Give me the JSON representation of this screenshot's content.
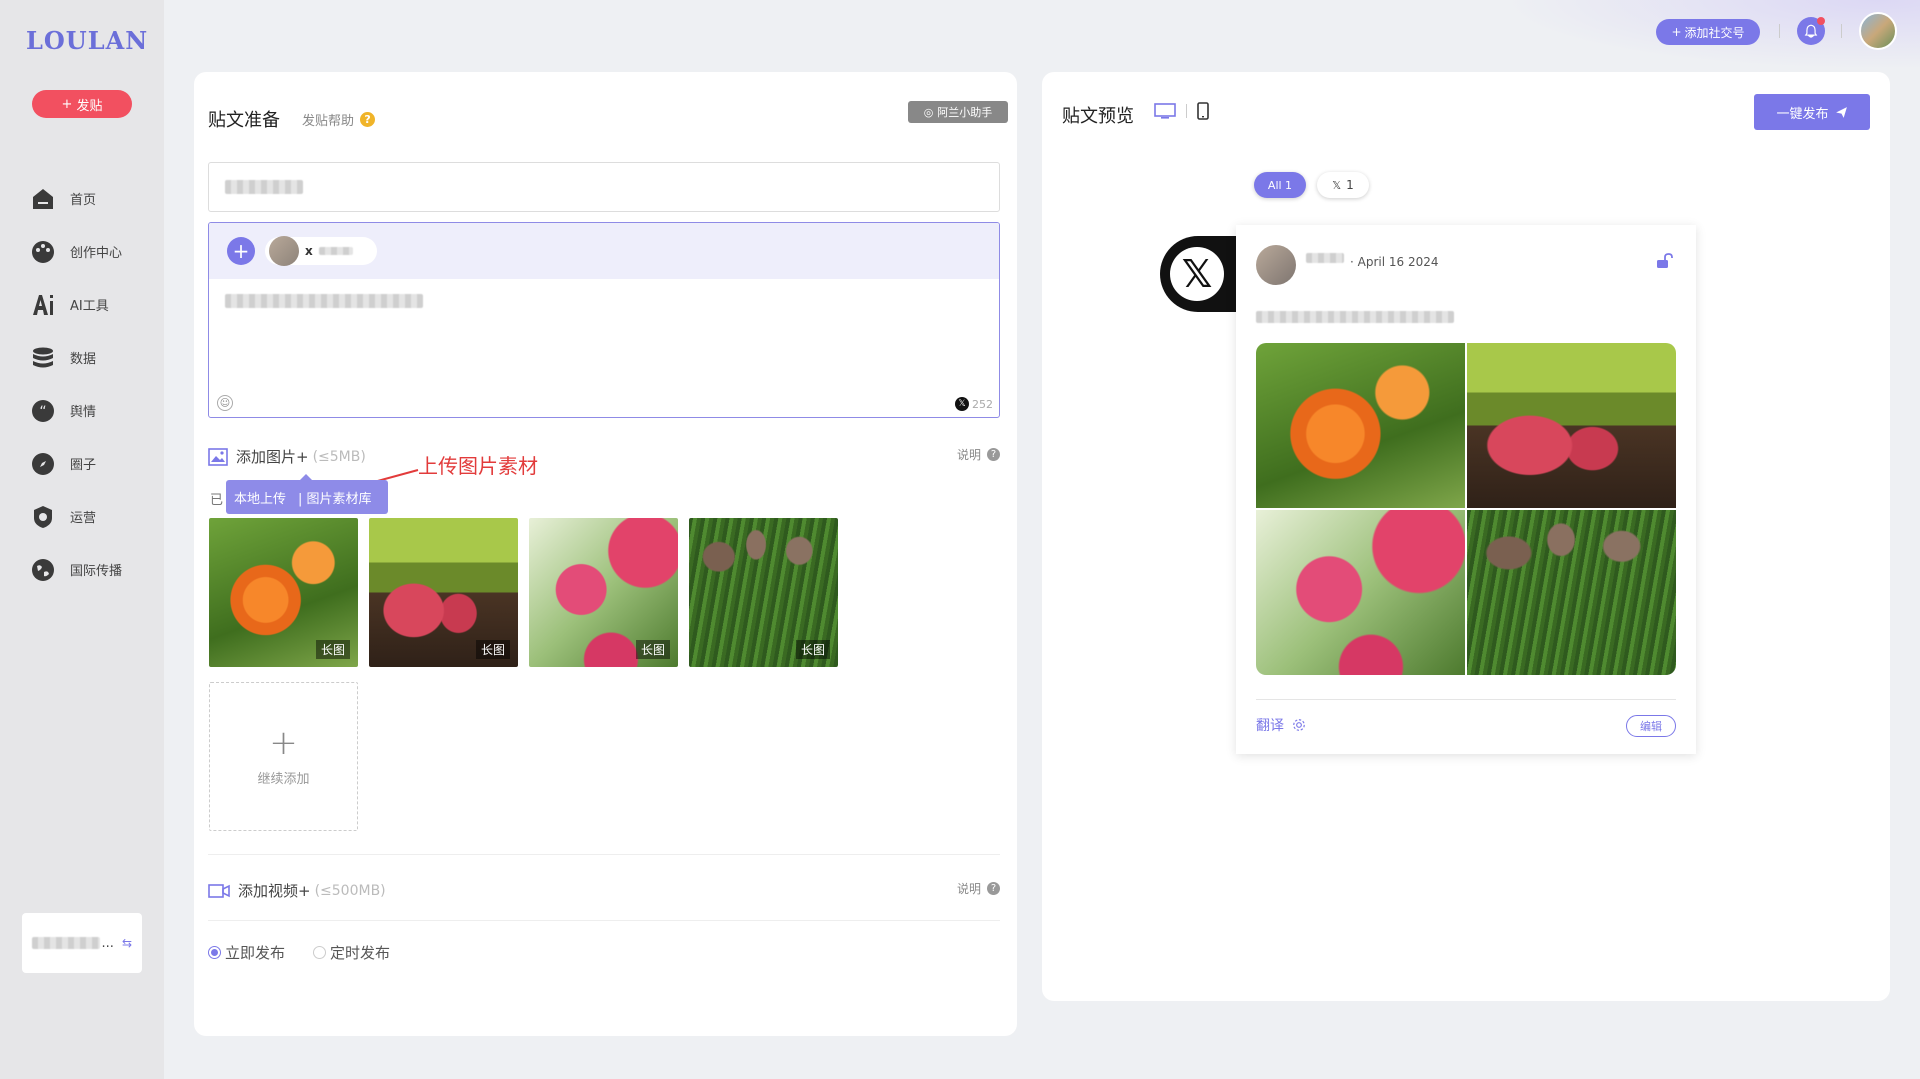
{
  "brand": {
    "logo": "LOULAN",
    "accent": "#7b78e8",
    "danger": "#f25060"
  },
  "sidebar": {
    "post_button": "发贴",
    "items": [
      {
        "label": "首页",
        "icon": "home-icon"
      },
      {
        "label": "创作中心",
        "icon": "palette-icon"
      },
      {
        "label": "AI工具",
        "icon": "ai-icon"
      },
      {
        "label": "数据",
        "icon": "database-icon"
      },
      {
        "label": "舆情",
        "icon": "quote-icon"
      },
      {
        "label": "圈子",
        "icon": "compass-icon"
      },
      {
        "label": "运营",
        "icon": "gear-badge-icon"
      },
      {
        "label": "国际传播",
        "icon": "globe-icon"
      }
    ],
    "account_card": "...",
    "account_switch_icon": "swap-icon"
  },
  "topbar": {
    "add_social": "添加社交号"
  },
  "left_panel": {
    "title": "贴文准备",
    "help": "发贴帮助",
    "help_badge": "?",
    "assistant_button": "阿兰小助手",
    "editor": {
      "chip_platform": "x",
      "char_count": "252"
    },
    "images": {
      "label": "添加图片+",
      "limit": "(≤5MB)",
      "explain": "说明",
      "annotation": "上传图片素材",
      "already_prefix": "已",
      "popover_local": "本地上传",
      "popover_library": "| 图片素材库",
      "thumbs": [
        {
          "tag": "长图",
          "name": "lily"
        },
        {
          "tag": "长图",
          "name": "radish"
        },
        {
          "tag": "长图",
          "name": "carnation"
        },
        {
          "tag": "长图",
          "name": "mushroom"
        }
      ],
      "add_more": "继续添加"
    },
    "video": {
      "label": "添加视频+",
      "limit": "(≤500MB)",
      "explain": "说明"
    },
    "schedule": {
      "now": "立即发布",
      "timed": "定时发布",
      "selected": "now"
    }
  },
  "right_panel": {
    "title": "贴文预览",
    "publish_button": "一键发布",
    "filter_all": "All 1",
    "filter_x": "1",
    "post": {
      "date": "· April 16 2024",
      "translate": "翻译",
      "edit": "编辑"
    }
  }
}
